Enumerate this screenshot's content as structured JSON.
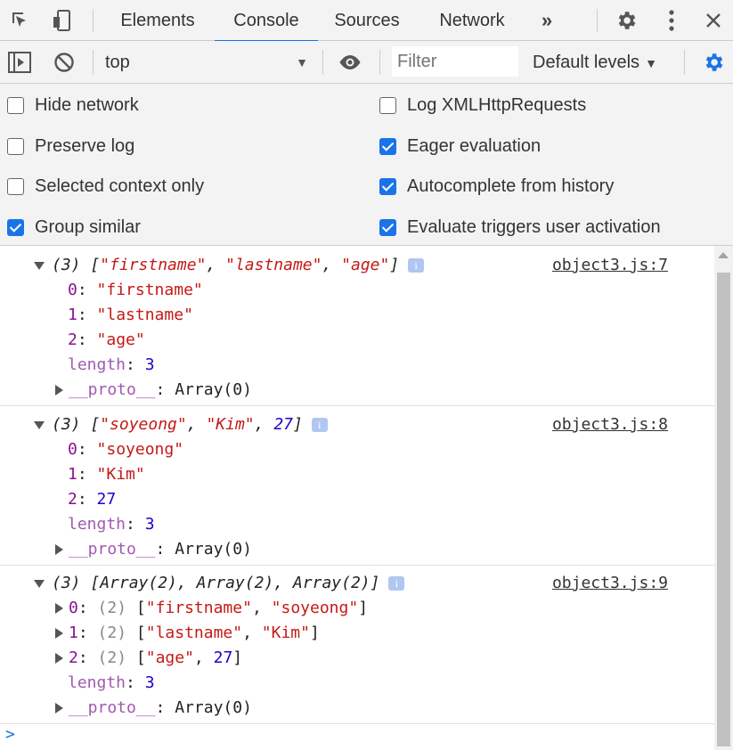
{
  "tabs": [
    {
      "label": "Elements"
    },
    {
      "label": "Console",
      "active": true
    },
    {
      "label": "Sources"
    },
    {
      "label": "Network"
    }
  ],
  "toolbar": {
    "context": "top",
    "filter_placeholder": "Filter",
    "levels": "Default levels"
  },
  "settings": {
    "left": [
      {
        "label": "Hide network",
        "checked": false
      },
      {
        "label": "Preserve log",
        "checked": false
      },
      {
        "label": "Selected context only",
        "checked": false
      },
      {
        "label": "Group similar",
        "checked": true
      }
    ],
    "right": [
      {
        "label": "Log XMLHttpRequests",
        "checked": false
      },
      {
        "label": "Eager evaluation",
        "checked": true
      },
      {
        "label": "Autocomplete from history",
        "checked": true
      },
      {
        "label": "Evaluate triggers user activation",
        "checked": true
      }
    ]
  },
  "console": {
    "messages": [
      {
        "source": "object3.js:7",
        "count": "(3)",
        "summary": [
          "\"firstname\"",
          "\"lastname\"",
          "\"age\""
        ],
        "entries": [
          {
            "key": "0",
            "value": "\"firstname\""
          },
          {
            "key": "1",
            "value": "\"lastname\""
          },
          {
            "key": "2",
            "value": "\"age\""
          }
        ],
        "length_label": "length",
        "length": "3",
        "proto_label": "__proto__",
        "proto": "Array(0)"
      },
      {
        "source": "object3.js:8",
        "count": "(3)",
        "summary": [
          "\"soyeong\"",
          "\"Kim\"",
          "27"
        ],
        "entries": [
          {
            "key": "0",
            "value": "\"soyeong\""
          },
          {
            "key": "1",
            "value": "\"Kim\""
          },
          {
            "key": "2",
            "value": "27"
          }
        ],
        "length_label": "length",
        "length": "3",
        "proto_label": "__proto__",
        "proto": "Array(0)"
      },
      {
        "source": "object3.js:9",
        "count": "(3)",
        "summary_text": "[Array(2), Array(2), Array(2)]",
        "entries": [
          {
            "key": "0",
            "count": "(2)",
            "items": [
              "\"firstname\"",
              "\"soyeong\""
            ]
          },
          {
            "key": "1",
            "count": "(2)",
            "items": [
              "\"lastname\"",
              "\"Kim\""
            ]
          },
          {
            "key": "2",
            "count": "(2)",
            "items": [
              "\"age\"",
              "27"
            ]
          }
        ],
        "length_label": "length",
        "length": "3",
        "proto_label": "__proto__",
        "proto": "Array(0)"
      }
    ],
    "prompt": ">"
  },
  "colors": {
    "accent": "#1a73e8",
    "string": "#c41a16",
    "key": "#881391",
    "number": "#1c00cf"
  }
}
